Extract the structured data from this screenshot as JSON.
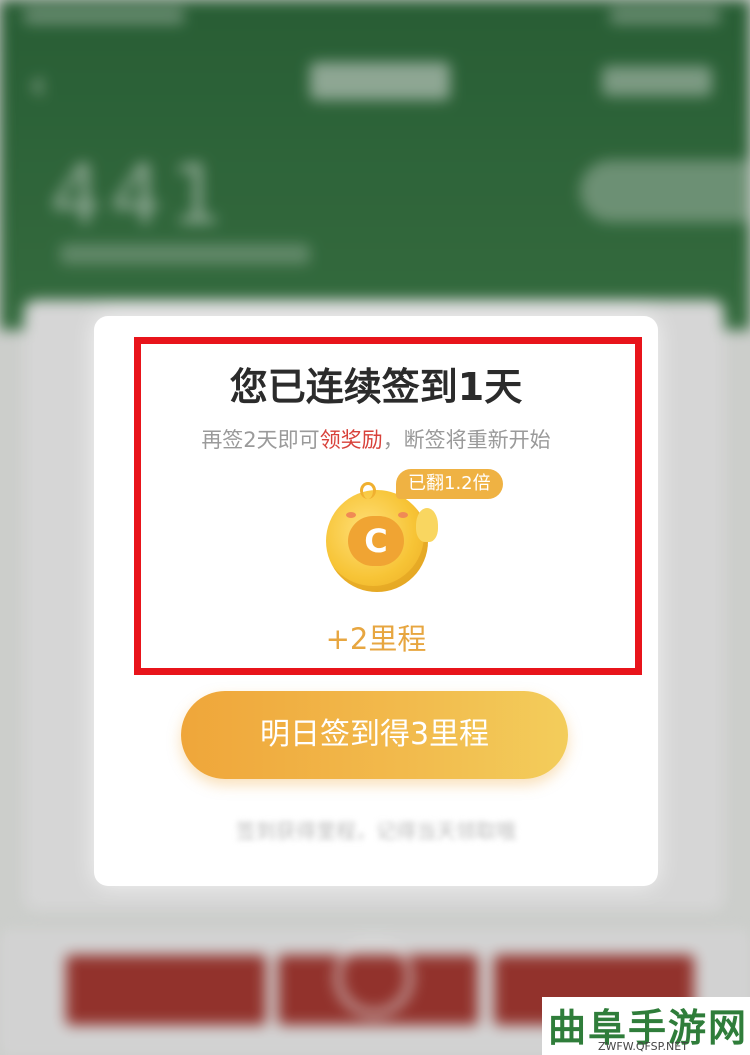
{
  "modal": {
    "title": "您已连续签到1天",
    "subtitle_pre": "再签2天即可",
    "subtitle_highlight": "领奖励",
    "subtitle_post": "，断签将重新开始",
    "badge": "已翻1.2倍",
    "coin_letter": "C",
    "reward": "+2里程",
    "cta_label": "明日签到得3里程",
    "footnote": "签到获得里程，记得当天领取哦"
  },
  "background": {
    "back_glyph": "‹",
    "big_number": "441"
  },
  "watermark": {
    "name": "曲阜手游网",
    "url": "ZWFW.QFSP.NET"
  },
  "colors": {
    "accent_orange": "#efa63a",
    "highlight_red": "#e8141b",
    "app_green": "#2e6b3c"
  }
}
